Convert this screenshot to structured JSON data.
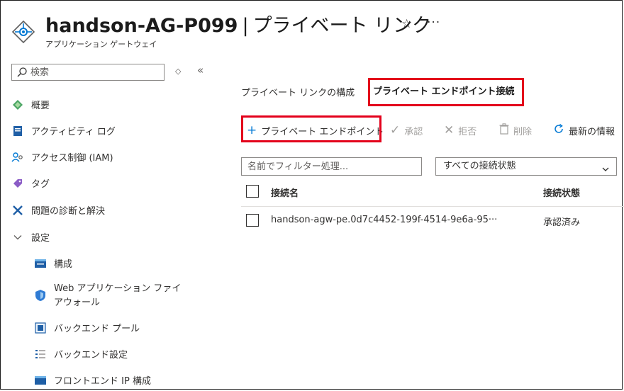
{
  "header": {
    "resource_name": "handson-AG-P099",
    "separator": "|",
    "page_name": "プライベート リンク",
    "resource_type": "アプリケーション ゲートウェイ",
    "more": "···"
  },
  "sidebar": {
    "search_placeholder": "検索",
    "collapse_glyph": "«",
    "items": [
      {
        "label": "概要",
        "icon": "overview-icon"
      },
      {
        "label": "アクティビティ ログ",
        "icon": "activity-log-icon"
      },
      {
        "label": "アクセス制御 (IAM)",
        "icon": "iam-icon"
      },
      {
        "label": "タグ",
        "icon": "tag-icon"
      },
      {
        "label": "問題の診断と解決",
        "icon": "diagnose-icon"
      },
      {
        "label": "設定",
        "icon": "chevron-down-icon"
      }
    ],
    "settings_items": [
      {
        "label": "構成",
        "icon": "configuration-icon"
      },
      {
        "label": "Web アプリケーション ファイアウォール",
        "icon": "waf-shield-icon"
      },
      {
        "label": "バックエンド プール",
        "icon": "backend-pool-icon"
      },
      {
        "label": "バックエンド設定",
        "icon": "backend-settings-icon"
      },
      {
        "label": "フロントエンド IP 構成",
        "icon": "frontend-ip-icon"
      }
    ]
  },
  "tabs": [
    {
      "label": "プライベート リンクの構成",
      "selected": false
    },
    {
      "label": "プライベート エンドポイント接続",
      "selected": true
    }
  ],
  "toolbar": {
    "add_label": "プライベート エンドポイント",
    "approve_label": "承認",
    "reject_label": "拒否",
    "delete_label": "削除",
    "refresh_label": "最新の情報"
  },
  "filter": {
    "placeholder": "名前でフィルター処理...",
    "state_selected": "すべての接続状態"
  },
  "table": {
    "columns": [
      "接続名",
      "接続状態"
    ],
    "rows": [
      {
        "name": "handson-agw-pe.0d7c4452-199f-4514-9e6a-95···",
        "state": "承認済み"
      }
    ]
  },
  "colors": {
    "accent": "#0078d4",
    "highlight": "#e3001b"
  }
}
